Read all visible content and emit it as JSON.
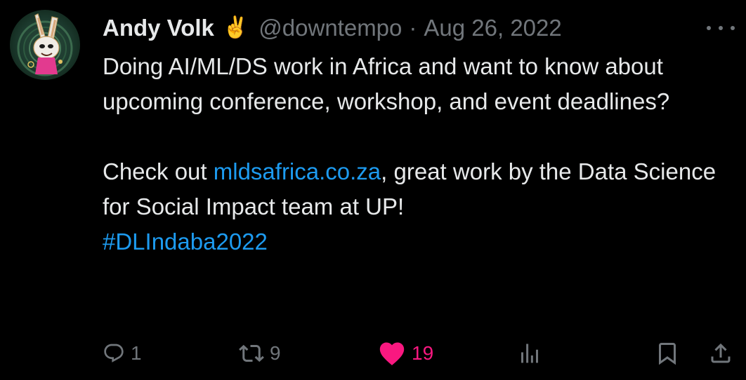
{
  "tweet": {
    "author": {
      "display_name": "Andy Volk",
      "emoji": "✌️",
      "handle": "@downtempo"
    },
    "separator": "·",
    "date": "Aug 26, 2022",
    "text": {
      "line1": "Doing AI/ML/DS work in Africa and want to know about upcoming conference, workshop, and event deadlines?",
      "check_out": "Check out ",
      "link": "mldsafrica.co.za",
      "after_link": ", great work by the Data Science for Social Impact team at UP!",
      "hashtag": "#DLIndaba2022"
    },
    "actions": {
      "reply": {
        "icon": "reply-icon",
        "count": "1"
      },
      "retweet": {
        "icon": "retweet-icon",
        "count": "9"
      },
      "like": {
        "icon": "heart-filled-icon",
        "count": "19",
        "liked": true
      },
      "views": {
        "icon": "analytics-icon"
      },
      "bookmark": {
        "icon": "bookmark-icon"
      },
      "share": {
        "icon": "share-icon"
      }
    },
    "colors": {
      "background": "#000000",
      "text": "#e7e9ea",
      "muted": "#71767b",
      "link": "#1d9bf0",
      "like": "#f91880"
    }
  }
}
